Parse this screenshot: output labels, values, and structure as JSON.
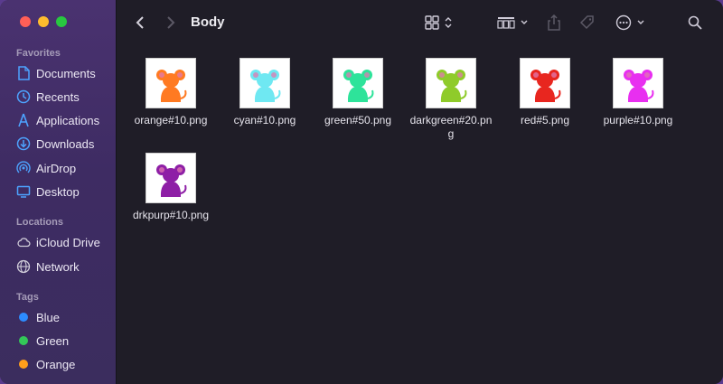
{
  "window": {
    "title": "Body"
  },
  "sidebar": {
    "favorites_title": "Favorites",
    "favorites": [
      {
        "label": "Documents",
        "icon": "document-icon"
      },
      {
        "label": "Recents",
        "icon": "clock-icon"
      },
      {
        "label": "Applications",
        "icon": "applications-icon"
      },
      {
        "label": "Downloads",
        "icon": "download-icon"
      },
      {
        "label": "AirDrop",
        "icon": "airdrop-icon"
      },
      {
        "label": "Desktop",
        "icon": "desktop-icon"
      }
    ],
    "locations_title": "Locations",
    "locations": [
      {
        "label": "iCloud Drive",
        "icon": "cloud-icon"
      },
      {
        "label": "Network",
        "icon": "globe-icon"
      }
    ],
    "tags_title": "Tags",
    "tags": [
      {
        "label": "Blue",
        "color": "#2d8cff"
      },
      {
        "label": "Green",
        "color": "#33c758"
      },
      {
        "label": "Orange",
        "color": "#ff9f1a"
      }
    ]
  },
  "files": [
    {
      "name": "orange#10.png",
      "color": "#ff7a22"
    },
    {
      "name": "cyan#10.png",
      "color": "#6fe8f2"
    },
    {
      "name": "green#50.png",
      "color": "#2ee39a"
    },
    {
      "name": "darkgreen#20.png",
      "color": "#8fcb2a"
    },
    {
      "name": "red#5.png",
      "color": "#e8261f"
    },
    {
      "name": "purple#10.png",
      "color": "#e82ff0"
    },
    {
      "name": "drkpurp#10.png",
      "color": "#8e1fa6"
    }
  ],
  "colors": {
    "accent": "#2d8cff",
    "sidebar_icon": "#4da3ff"
  }
}
